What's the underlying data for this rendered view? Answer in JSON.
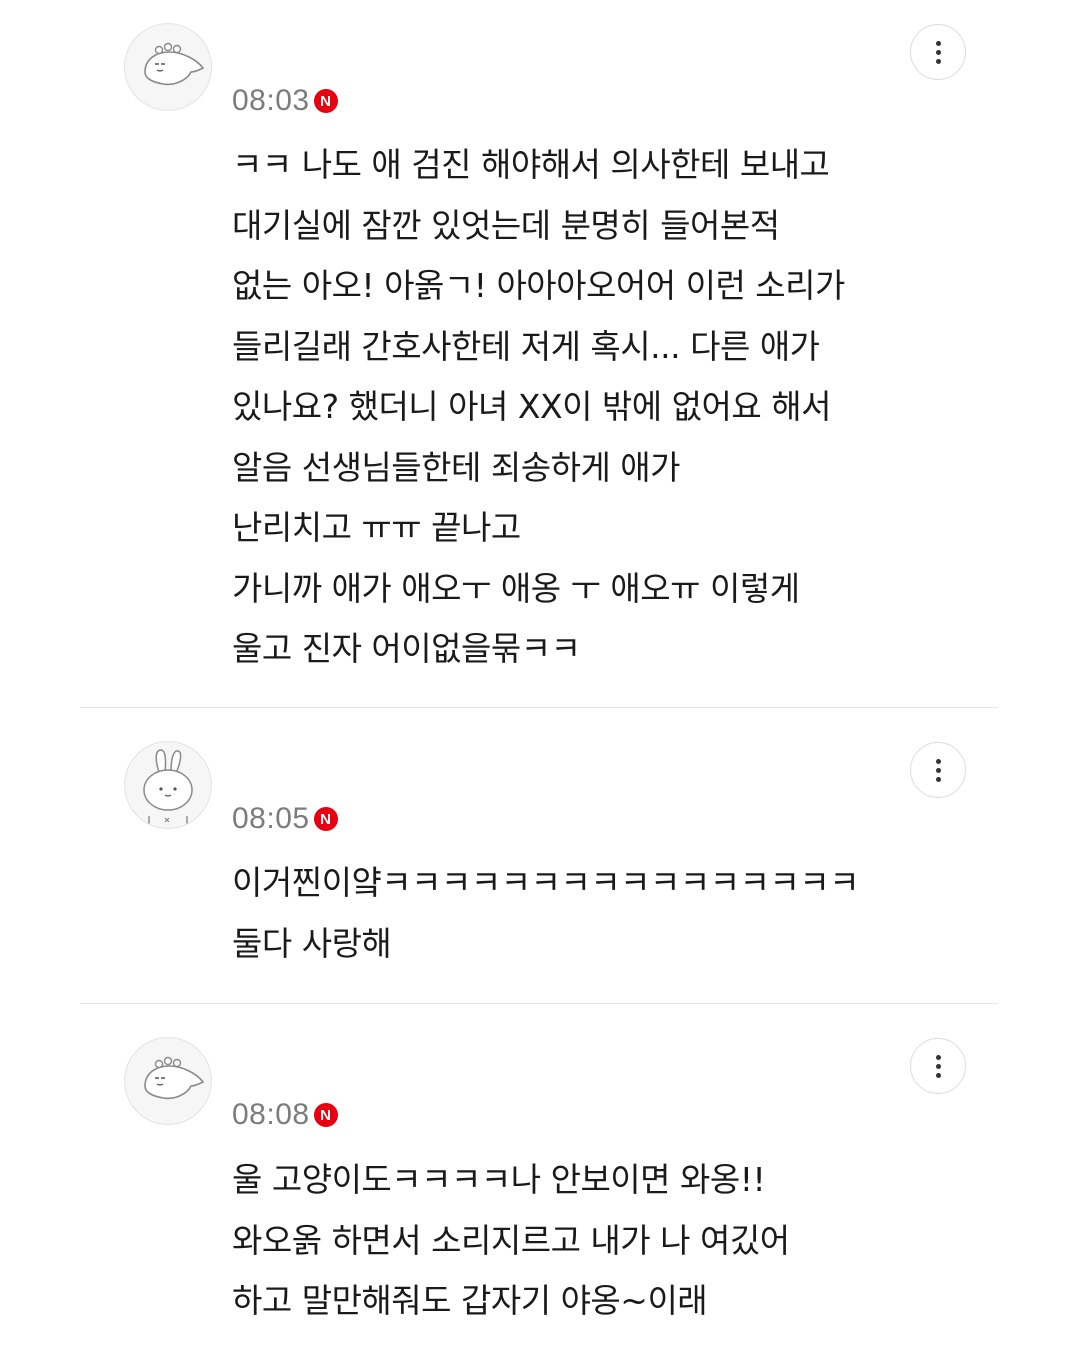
{
  "comments": [
    {
      "avatar_icon": "dinosaur-avatar-icon",
      "time": "08:03",
      "badge": "N",
      "more_icon": "more-vertical-icon",
      "lines": [
        "ㅋㅋ 나도 애 검진 해야해서 의사한테 보내고",
        "대기실에 잠깐 있엇는데 분명히 들어본적",
        "없는 아오! 아옭ㄱ! 아아아오어어 이런 소리가",
        "들리길래 간호사한테 저게 혹시... 다른 애가",
        "있나요? 했더니 아녀 XX이 밖에 없어요 해서",
        "알음 선생님들한테 죄송하게 애가",
        "난리치고 ㅠㅠ 끝나고",
        "가니까 애가 애오ㅜ 애옹 ㅜ 애오ㅠ 이렇게",
        "울고 진자 어이없을묶ㅋㅋ"
      ]
    },
    {
      "avatar_icon": "rabbit-avatar-icon",
      "time": "08:05",
      "badge": "N",
      "more_icon": "more-vertical-icon",
      "lines": [
        "이거찐이얔ㅋㅋㅋㅋㅋㅋㅋㅋㅋㅋㅋㅋㅋㅋㅋㅋ",
        "둘다 사랑해"
      ]
    },
    {
      "avatar_icon": "dinosaur-avatar-icon",
      "time": "08:08",
      "badge": "N",
      "more_icon": "more-vertical-icon",
      "lines": [
        "울 고양이도ㅋㅋㅋㅋ나 안보이면 와옹!!",
        "와오옭 하면서 소리지르고 내가 나 여깄어",
        "하고 말만해줘도 갑자기 야옹~이래"
      ]
    }
  ],
  "colors": {
    "badge": "#e60012",
    "time": "#7c7c7c",
    "text": "#1a1a1a",
    "divider": "#e6e6e6"
  }
}
